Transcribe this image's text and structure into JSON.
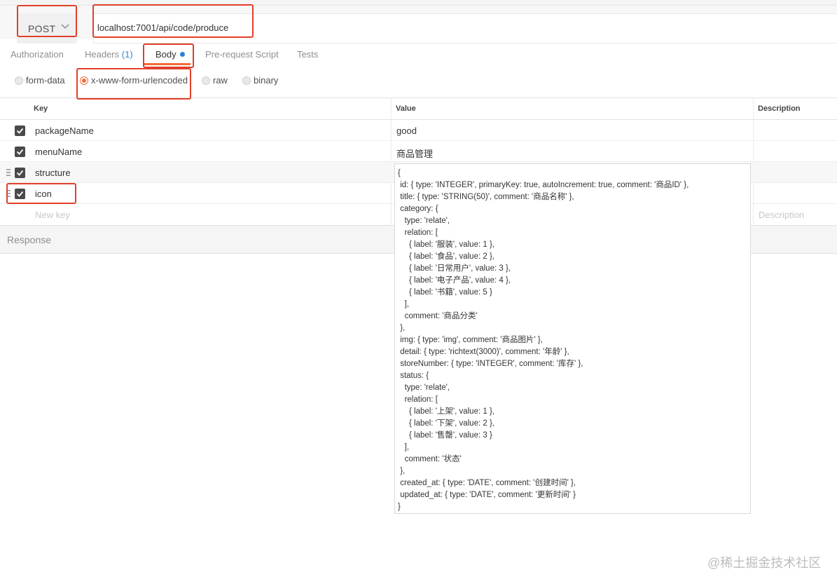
{
  "request": {
    "method": "POST",
    "url": "localhost:7001/api/code/produce"
  },
  "tabs": {
    "authorization": "Authorization",
    "headers": "Headers",
    "headers_count": "(1)",
    "body": "Body",
    "prerequest": "Pre-request Script",
    "tests": "Tests"
  },
  "body_modes": {
    "form_data": "form-data",
    "urlencoded": "x-www-form-urlencoded",
    "raw": "raw",
    "binary": "binary",
    "selected": "x-www-form-urlencoded"
  },
  "table": {
    "headers": {
      "key": "Key",
      "value": "Value",
      "description": "Description"
    },
    "rows": [
      {
        "key": "packageName",
        "value": "good",
        "checked": true
      },
      {
        "key": "menuName",
        "value": "商品管理",
        "checked": true
      },
      {
        "key": "structure",
        "value": "",
        "checked": true
      },
      {
        "key": "icon",
        "value": "",
        "checked": true
      }
    ],
    "new_key_placeholder": "New key",
    "description_placeholder": "Description"
  },
  "response_label": "Response",
  "structure_value": "{\n id: { type: 'INTEGER', primaryKey: true, autoIncrement: true, comment: '商品ID' },\n title: { type: 'STRING(50)', comment: '商品名称' },\n category: {\n   type: 'relate',\n   relation: [\n     { label: '服装', value: 1 },\n     { label: '食品', value: 2 },\n     { label: '日常用户', value: 3 },\n     { label: '电子产品', value: 4 },\n     { label: '书籍', value: 5 }\n   ],\n   comment: '商品分类'\n },\n img: { type: 'img', comment: '商品图片' },\n detail: { type: 'richtext(3000)', comment: '年龄' },\n storeNumber: { type: 'INTEGER', comment: '库存' },\n status: {\n   type: 'relate',\n   relation: [\n     { label: '上架', value: 1 },\n     { label: '下架', value: 2 },\n     { label: '售罄', value: 3 }\n   ],\n   comment: '状态'\n },\n created_at: { type: 'DATE', comment: '创建时间' },\n updated_at: { type: 'DATE', comment: '更新时间' }\n}",
  "watermark": "@稀土掘金技术社区",
  "colors": {
    "accent": "#f26b3a",
    "highlight": "#e1402c",
    "dot": "#2a7fdf",
    "count": "#2b8ad2"
  }
}
